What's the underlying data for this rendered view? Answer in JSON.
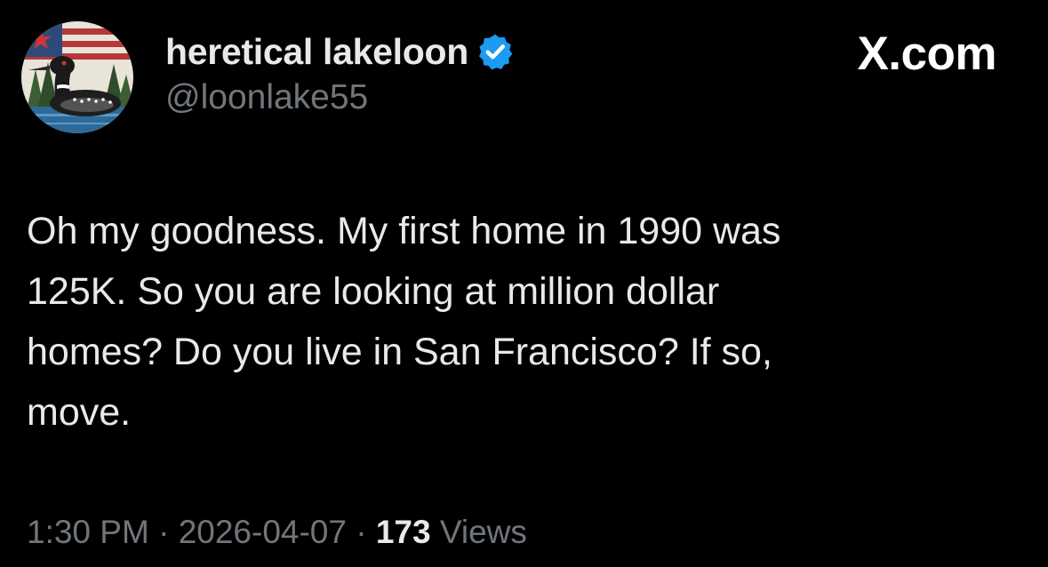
{
  "tweet": {
    "author": {
      "display_name": "heretical lakeloon",
      "handle": "@loonlake55",
      "verified": true,
      "avatar_icon": "loon-avatar-icon"
    },
    "watermark": "X.com",
    "text": "Oh my goodness. My first home in 1990 was\n125K. So you are looking at million dollar\nhomes? Do you live in San Francisco? If so,\nmove.",
    "time": "1:30 PM",
    "separator": "·",
    "date": "2026-04-07",
    "views_count": "173",
    "views_label": "Views"
  },
  "colors": {
    "background": "#000000",
    "primary_text": "#e7e9ea",
    "secondary_text": "#71767b",
    "verified_badge": "#1d9bf0"
  }
}
